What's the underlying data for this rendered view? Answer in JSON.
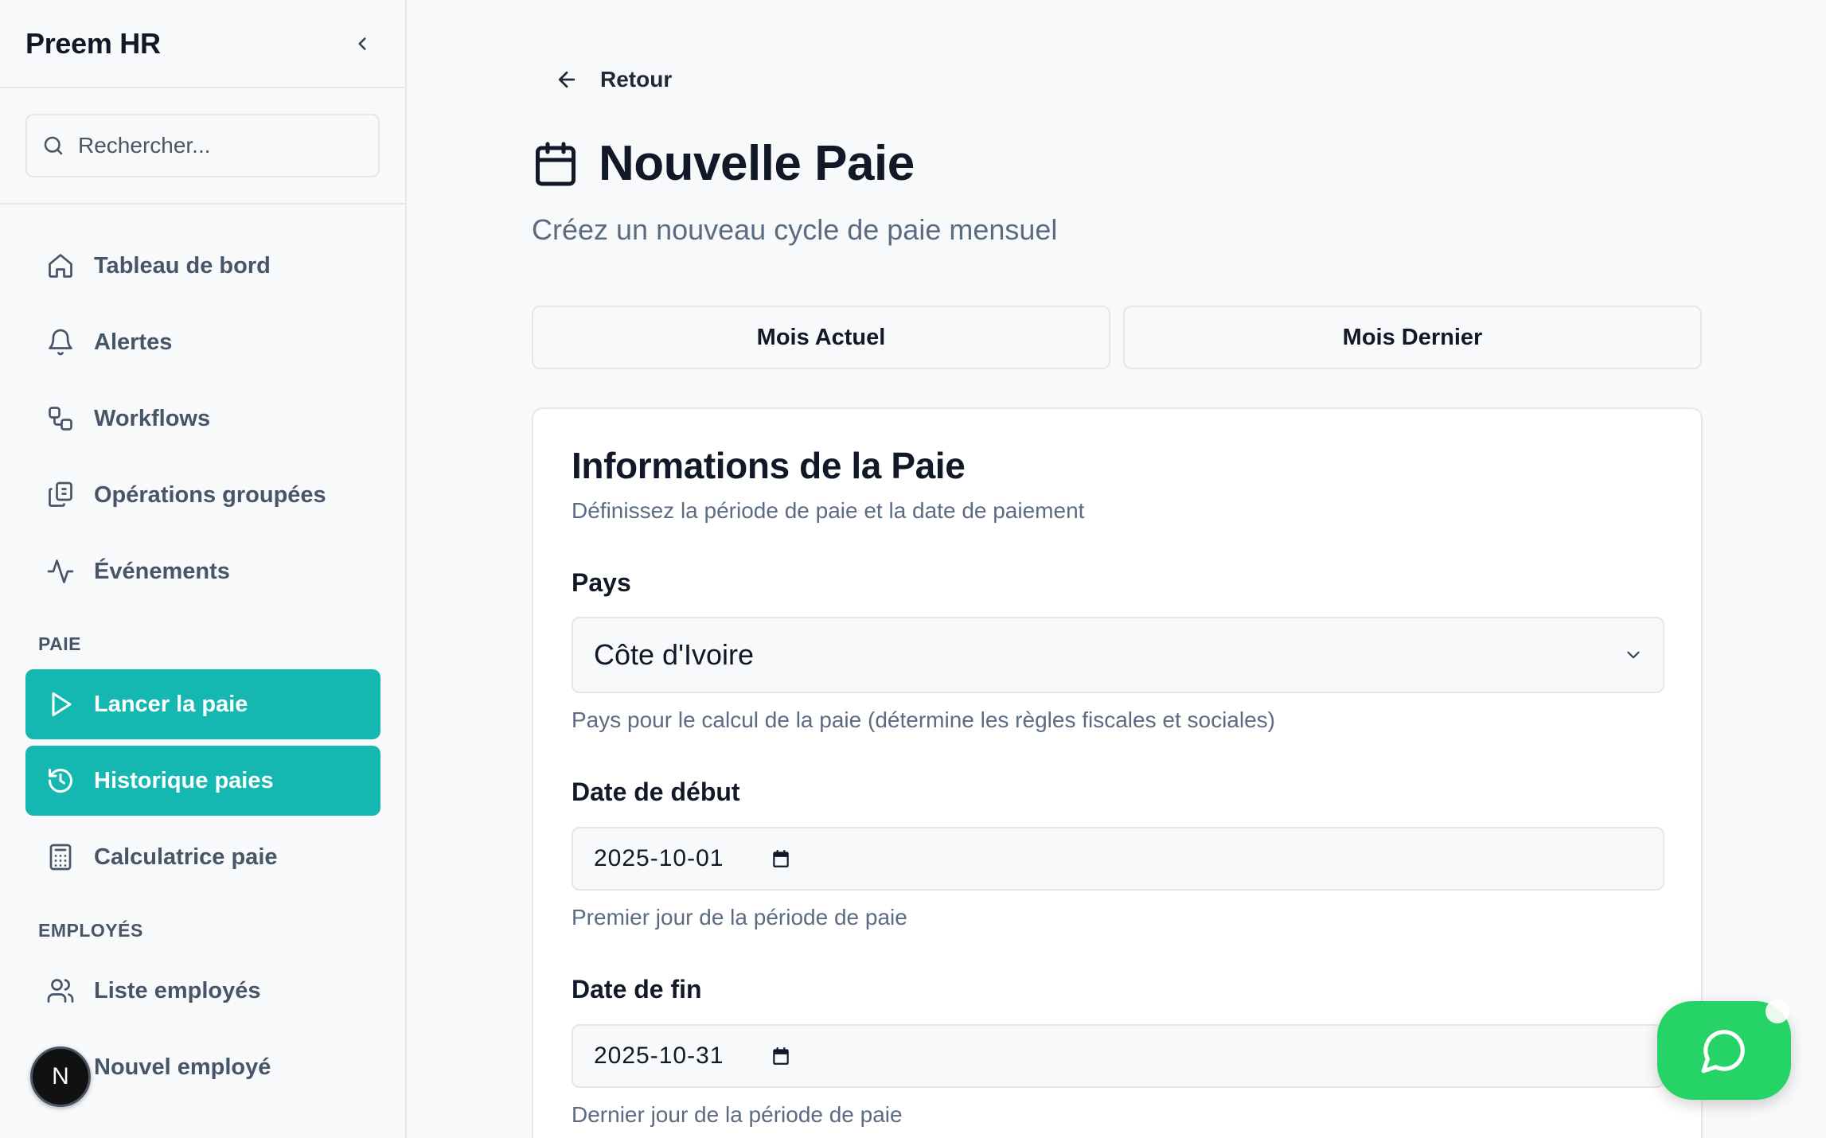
{
  "sidebar": {
    "app_title": "Preem HR",
    "search_placeholder": "Rechercher...",
    "items": [
      {
        "label": "Tableau de bord",
        "icon": "home-icon"
      },
      {
        "label": "Alertes",
        "icon": "bell-icon"
      },
      {
        "label": "Workflows",
        "icon": "workflow-icon"
      },
      {
        "label": "Opérations groupées",
        "icon": "copy-icon"
      },
      {
        "label": "Événements",
        "icon": "activity-icon"
      }
    ],
    "sections": [
      {
        "title": "PAIE",
        "items": [
          {
            "label": "Lancer la paie",
            "icon": "play-icon",
            "active": true
          },
          {
            "label": "Historique paies",
            "icon": "history-icon",
            "active": true
          },
          {
            "label": "Calculatrice paie",
            "icon": "calculator-icon",
            "active": false
          }
        ]
      },
      {
        "title": "EMPLOYÉS",
        "items": [
          {
            "label": "Liste employés",
            "icon": "users-icon"
          },
          {
            "label": "Nouvel employé",
            "icon": "user-plus-icon"
          }
        ]
      }
    ],
    "badge_letter": "N"
  },
  "main": {
    "back_label": "Retour",
    "title": "Nouvelle Paie",
    "subtitle": "Créez un nouveau cycle de paie mensuel",
    "quick_buttons": [
      "Mois Actuel",
      "Mois Dernier"
    ],
    "card": {
      "title": "Informations de la Paie",
      "description": "Définissez la période de paie et la date de paiement",
      "fields": {
        "country": {
          "label": "Pays",
          "value": "Côte d'Ivoire",
          "help": "Pays pour le calcul de la paie (détermine les règles fiscales et sociales)"
        },
        "start_date": {
          "label": "Date de début",
          "value": "2025-10-01",
          "help": "Premier jour de la période de paie"
        },
        "end_date": {
          "label": "Date de fin",
          "value": "2025-10-31",
          "help": "Dernier jour de la période de paie"
        }
      }
    }
  },
  "colors": {
    "accent": "#14b8b0",
    "chat": "#25d366",
    "text_muted": "#5b6b82"
  }
}
